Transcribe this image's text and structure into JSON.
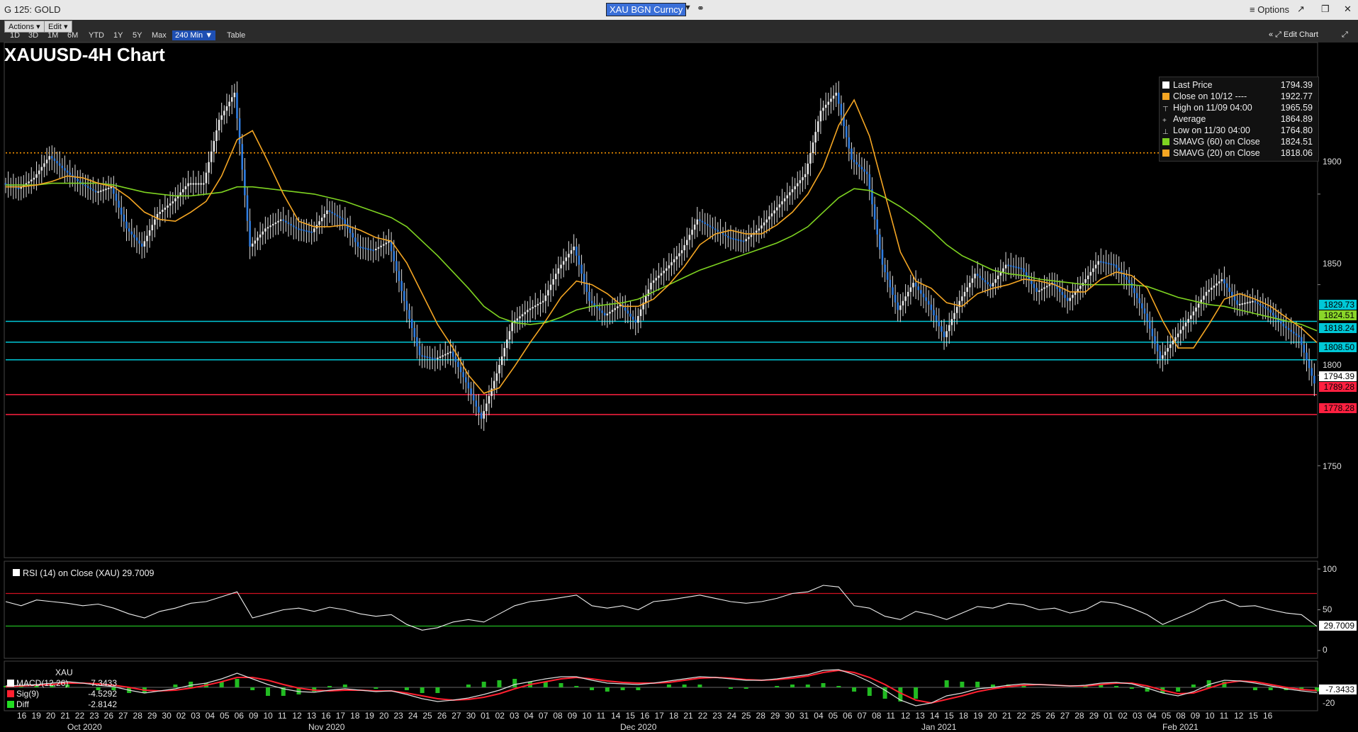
{
  "window": {
    "title": "G 125: GOLD",
    "ticker": "XAU BGN Curncy",
    "options_label": "Options"
  },
  "toolbar": {
    "actions_label": "Actions",
    "edit_label": "Edit",
    "ranges": [
      "1D",
      "3D",
      "1M",
      "6M",
      "YTD",
      "1Y",
      "5Y",
      "Max",
      "240 Min",
      "Table"
    ],
    "active_range": "240 Min",
    "edit_chart_label": "Edit Chart"
  },
  "chart_title": "XAUUSD-4H Chart",
  "legend": [
    {
      "label": "Last Price",
      "value": "1794.39",
      "color": "#ffffff"
    },
    {
      "label": "Close on 10/12 ----",
      "value": "1922.77",
      "color": "#f5a623"
    },
    {
      "label": "High on 11/09 04:00",
      "value": "1965.59",
      "color": ""
    },
    {
      "label": "Average",
      "value": "1864.89",
      "color": ""
    },
    {
      "label": "Low on 11/30 04:00",
      "value": "1764.80",
      "color": ""
    },
    {
      "label": "SMAVG (60)  on Close",
      "value": "1824.51",
      "color": "#7ed321"
    },
    {
      "label": "SMAVG (20)  on Close",
      "value": "1818.06",
      "color": "#f5a623"
    }
  ],
  "price_axis": {
    "ticks": [
      "1900",
      "1850",
      "1800",
      "1750"
    ]
  },
  "price_tags": [
    {
      "value": "1829.73",
      "color": "#00c8d7",
      "text_color": "#000"
    },
    {
      "value": "1824.51",
      "color": "#8ad629",
      "text_color": "#000"
    },
    {
      "value": "1818.24",
      "color": "#00c8d7",
      "text_color": "#000"
    },
    {
      "value": "1808.50",
      "color": "#00c8d7",
      "text_color": "#000"
    },
    {
      "value": "1794.39",
      "color": "#ffffff",
      "text_color": "#000"
    },
    {
      "value": "1789.28",
      "color": "#ff2040",
      "text_color": "#000"
    },
    {
      "value": "1778.28",
      "color": "#ff2040",
      "text_color": "#000"
    }
  ],
  "rsi": {
    "label": "RSI (14)  on Close (XAU) 29.7009",
    "value": "29.7009",
    "axis_ticks": [
      "100",
      "50",
      "0"
    ]
  },
  "macd": {
    "header": "XAU",
    "rows": [
      {
        "label": "MACD(12,26)",
        "value": "-7.3433",
        "color": "#ffffff"
      },
      {
        "label": "Sig(9)",
        "value": "-4.5292",
        "color": "#ff2030"
      },
      {
        "label": "Diff",
        "value": "-2.8142",
        "color": "#22dd22"
      }
    ],
    "tag_value": "-7.3433",
    "axis_ticks": [
      "-20"
    ]
  },
  "x_axis": {
    "days": [
      "16",
      "19",
      "20",
      "21",
      "22",
      "23",
      "26",
      "27",
      "28",
      "29",
      "30",
      "02",
      "03",
      "04",
      "05",
      "06",
      "09",
      "10",
      "11",
      "12",
      "13",
      "16",
      "17",
      "18",
      "19",
      "20",
      "23",
      "24",
      "25",
      "26",
      "27",
      "30",
      "01",
      "02",
      "03",
      "04",
      "07",
      "08",
      "09",
      "10",
      "11",
      "14",
      "15",
      "16",
      "17",
      "18",
      "21",
      "22",
      "23",
      "24",
      "25",
      "28",
      "29",
      "30",
      "31",
      "04",
      "05",
      "06",
      "07",
      "08",
      "11",
      "12",
      "13",
      "14",
      "15",
      "18",
      "19",
      "20",
      "21",
      "22",
      "25",
      "26",
      "27",
      "28",
      "29",
      "01",
      "02",
      "03",
      "04",
      "05",
      "08",
      "09",
      "10",
      "11",
      "12",
      "15",
      "16"
    ],
    "months": [
      "Oct 2020",
      "Nov 2020",
      "Dec 2020",
      "Jan 2021",
      "Feb 2021"
    ]
  },
  "chart_data": {
    "type": "line",
    "title": "XAUUSD-4H Chart",
    "ylim": [
      1700,
      1970
    ],
    "series": [
      {
        "name": "Last Price",
        "values": [
          1905,
          1902,
          1908,
          1920,
          1912,
          1905,
          1900,
          1903,
          1880,
          1870,
          1888,
          1895,
          1905,
          1905,
          1940,
          1955,
          1870,
          1880,
          1885,
          1880,
          1878,
          1890,
          1885,
          1870,
          1868,
          1873,
          1840,
          1810,
          1808,
          1812,
          1795,
          1775,
          1800,
          1828,
          1835,
          1840,
          1858,
          1870,
          1840,
          1832,
          1838,
          1828,
          1850,
          1858,
          1868,
          1885,
          1880,
          1875,
          1873,
          1880,
          1890,
          1900,
          1910,
          1945,
          1955,
          1918,
          1910,
          1860,
          1835,
          1850,
          1838,
          1820,
          1840,
          1855,
          1848,
          1860,
          1858,
          1845,
          1850,
          1840,
          1850,
          1862,
          1860,
          1850,
          1833,
          1808,
          1820,
          1832,
          1845,
          1852,
          1838,
          1840,
          1835,
          1826,
          1820,
          1794.39
        ]
      },
      {
        "name": "SMAVG (60) on Close",
        "values": [
          1905,
          1905,
          1905,
          1906,
          1906,
          1906,
          1906,
          1905,
          1903,
          1901,
          1900,
          1899,
          1899,
          1900,
          1901,
          1904,
          1904,
          1903,
          1902,
          1901,
          1900,
          1898,
          1896,
          1893,
          1890,
          1887,
          1882,
          1874,
          1866,
          1857,
          1848,
          1838,
          1832,
          1829,
          1828,
          1829,
          1832,
          1836,
          1838,
          1839,
          1840,
          1842,
          1846,
          1850,
          1854,
          1858,
          1861,
          1864,
          1867,
          1870,
          1873,
          1877,
          1882,
          1890,
          1898,
          1903,
          1902,
          1898,
          1893,
          1887,
          1880,
          1872,
          1866,
          1862,
          1858,
          1856,
          1855,
          1853,
          1852,
          1851,
          1850,
          1850,
          1850,
          1850,
          1849,
          1846,
          1843,
          1841,
          1839,
          1838,
          1836,
          1834,
          1832,
          1830,
          1828,
          1824.51
        ]
      },
      {
        "name": "SMAVG (20) on Close",
        "values": [
          1904,
          1904,
          1905,
          1907,
          1910,
          1909,
          1906,
          1904,
          1898,
          1890,
          1886,
          1885,
          1890,
          1896,
          1910,
          1930,
          1935,
          1918,
          1900,
          1885,
          1882,
          1882,
          1883,
          1880,
          1876,
          1874,
          1862,
          1845,
          1828,
          1815,
          1800,
          1790,
          1793,
          1805,
          1818,
          1830,
          1843,
          1852,
          1850,
          1845,
          1838,
          1838,
          1842,
          1850,
          1860,
          1872,
          1878,
          1880,
          1878,
          1878,
          1883,
          1890,
          1900,
          1915,
          1938,
          1952,
          1932,
          1900,
          1868,
          1852,
          1848,
          1840,
          1838,
          1845,
          1848,
          1850,
          1853,
          1852,
          1850,
          1846,
          1846,
          1853,
          1857,
          1855,
          1848,
          1830,
          1815,
          1815,
          1828,
          1842,
          1845,
          1842,
          1838,
          1832,
          1826,
          1818.06
        ]
      }
    ],
    "hlines": [
      1922.77,
      1829.73,
      1818.24,
      1808.5,
      1789.28,
      1778.28
    ],
    "rsi_values": [
      60,
      55,
      62,
      60,
      58,
      55,
      57,
      52,
      45,
      40,
      48,
      52,
      58,
      60,
      66,
      72,
      40,
      45,
      50,
      52,
      48,
      53,
      50,
      45,
      42,
      44,
      32,
      25,
      28,
      35,
      38,
      35,
      45,
      55,
      60,
      62,
      65,
      68,
      55,
      52,
      55,
      50,
      60,
      62,
      65,
      68,
      64,
      60,
      58,
      60,
      64,
      70,
      72,
      80,
      78,
      55,
      52,
      42,
      38,
      48,
      44,
      38,
      46,
      54,
      52,
      58,
      56,
      50,
      52,
      46,
      50,
      60,
      58,
      52,
      44,
      32,
      40,
      48,
      58,
      62,
      54,
      55,
      50,
      46,
      44,
      29.7009
    ],
    "rsi_bands": [
      70,
      30
    ],
    "macd_values": [
      2,
      3,
      4,
      6,
      8,
      6,
      3,
      1,
      -4,
      -8,
      -5,
      -2,
      3,
      6,
      12,
      20,
      12,
      4,
      -2,
      -6,
      -7,
      -4,
      -2,
      -4,
      -6,
      -5,
      -10,
      -16,
      -20,
      -18,
      -15,
      -10,
      -4,
      4,
      8,
      12,
      15,
      15,
      10,
      6,
      5,
      4,
      6,
      9,
      12,
      15,
      14,
      12,
      10,
      10,
      12,
      15,
      18,
      24,
      25,
      18,
      8,
      -4,
      -18,
      -26,
      -22,
      -12,
      -8,
      -2,
      0,
      3,
      5,
      4,
      3,
      2,
      3,
      6,
      7,
      5,
      -1,
      -8,
      -12,
      -6,
      4,
      10,
      9,
      6,
      2,
      -2,
      -5,
      -7.3433
    ],
    "macd_signal_values": [
      1,
      2,
      3,
      4,
      6,
      6,
      5,
      3,
      0,
      -4,
      -5,
      -4,
      -1,
      3,
      8,
      14,
      14,
      10,
      4,
      -1,
      -4,
      -5,
      -4,
      -4,
      -5,
      -5,
      -8,
      -12,
      -16,
      -18,
      -17,
      -14,
      -9,
      -2,
      4,
      8,
      12,
      14,
      12,
      9,
      7,
      6,
      6,
      7,
      10,
      13,
      14,
      13,
      11,
      10,
      11,
      13,
      16,
      21,
      24,
      21,
      14,
      4,
      -8,
      -18,
      -22,
      -17,
      -12,
      -6,
      -2,
      1,
      3,
      4,
      3,
      2,
      2,
      4,
      6,
      6,
      2,
      -4,
      -9,
      -8,
      -1,
      6,
      9,
      8,
      4,
      0,
      -3,
      -4.5292
    ]
  }
}
